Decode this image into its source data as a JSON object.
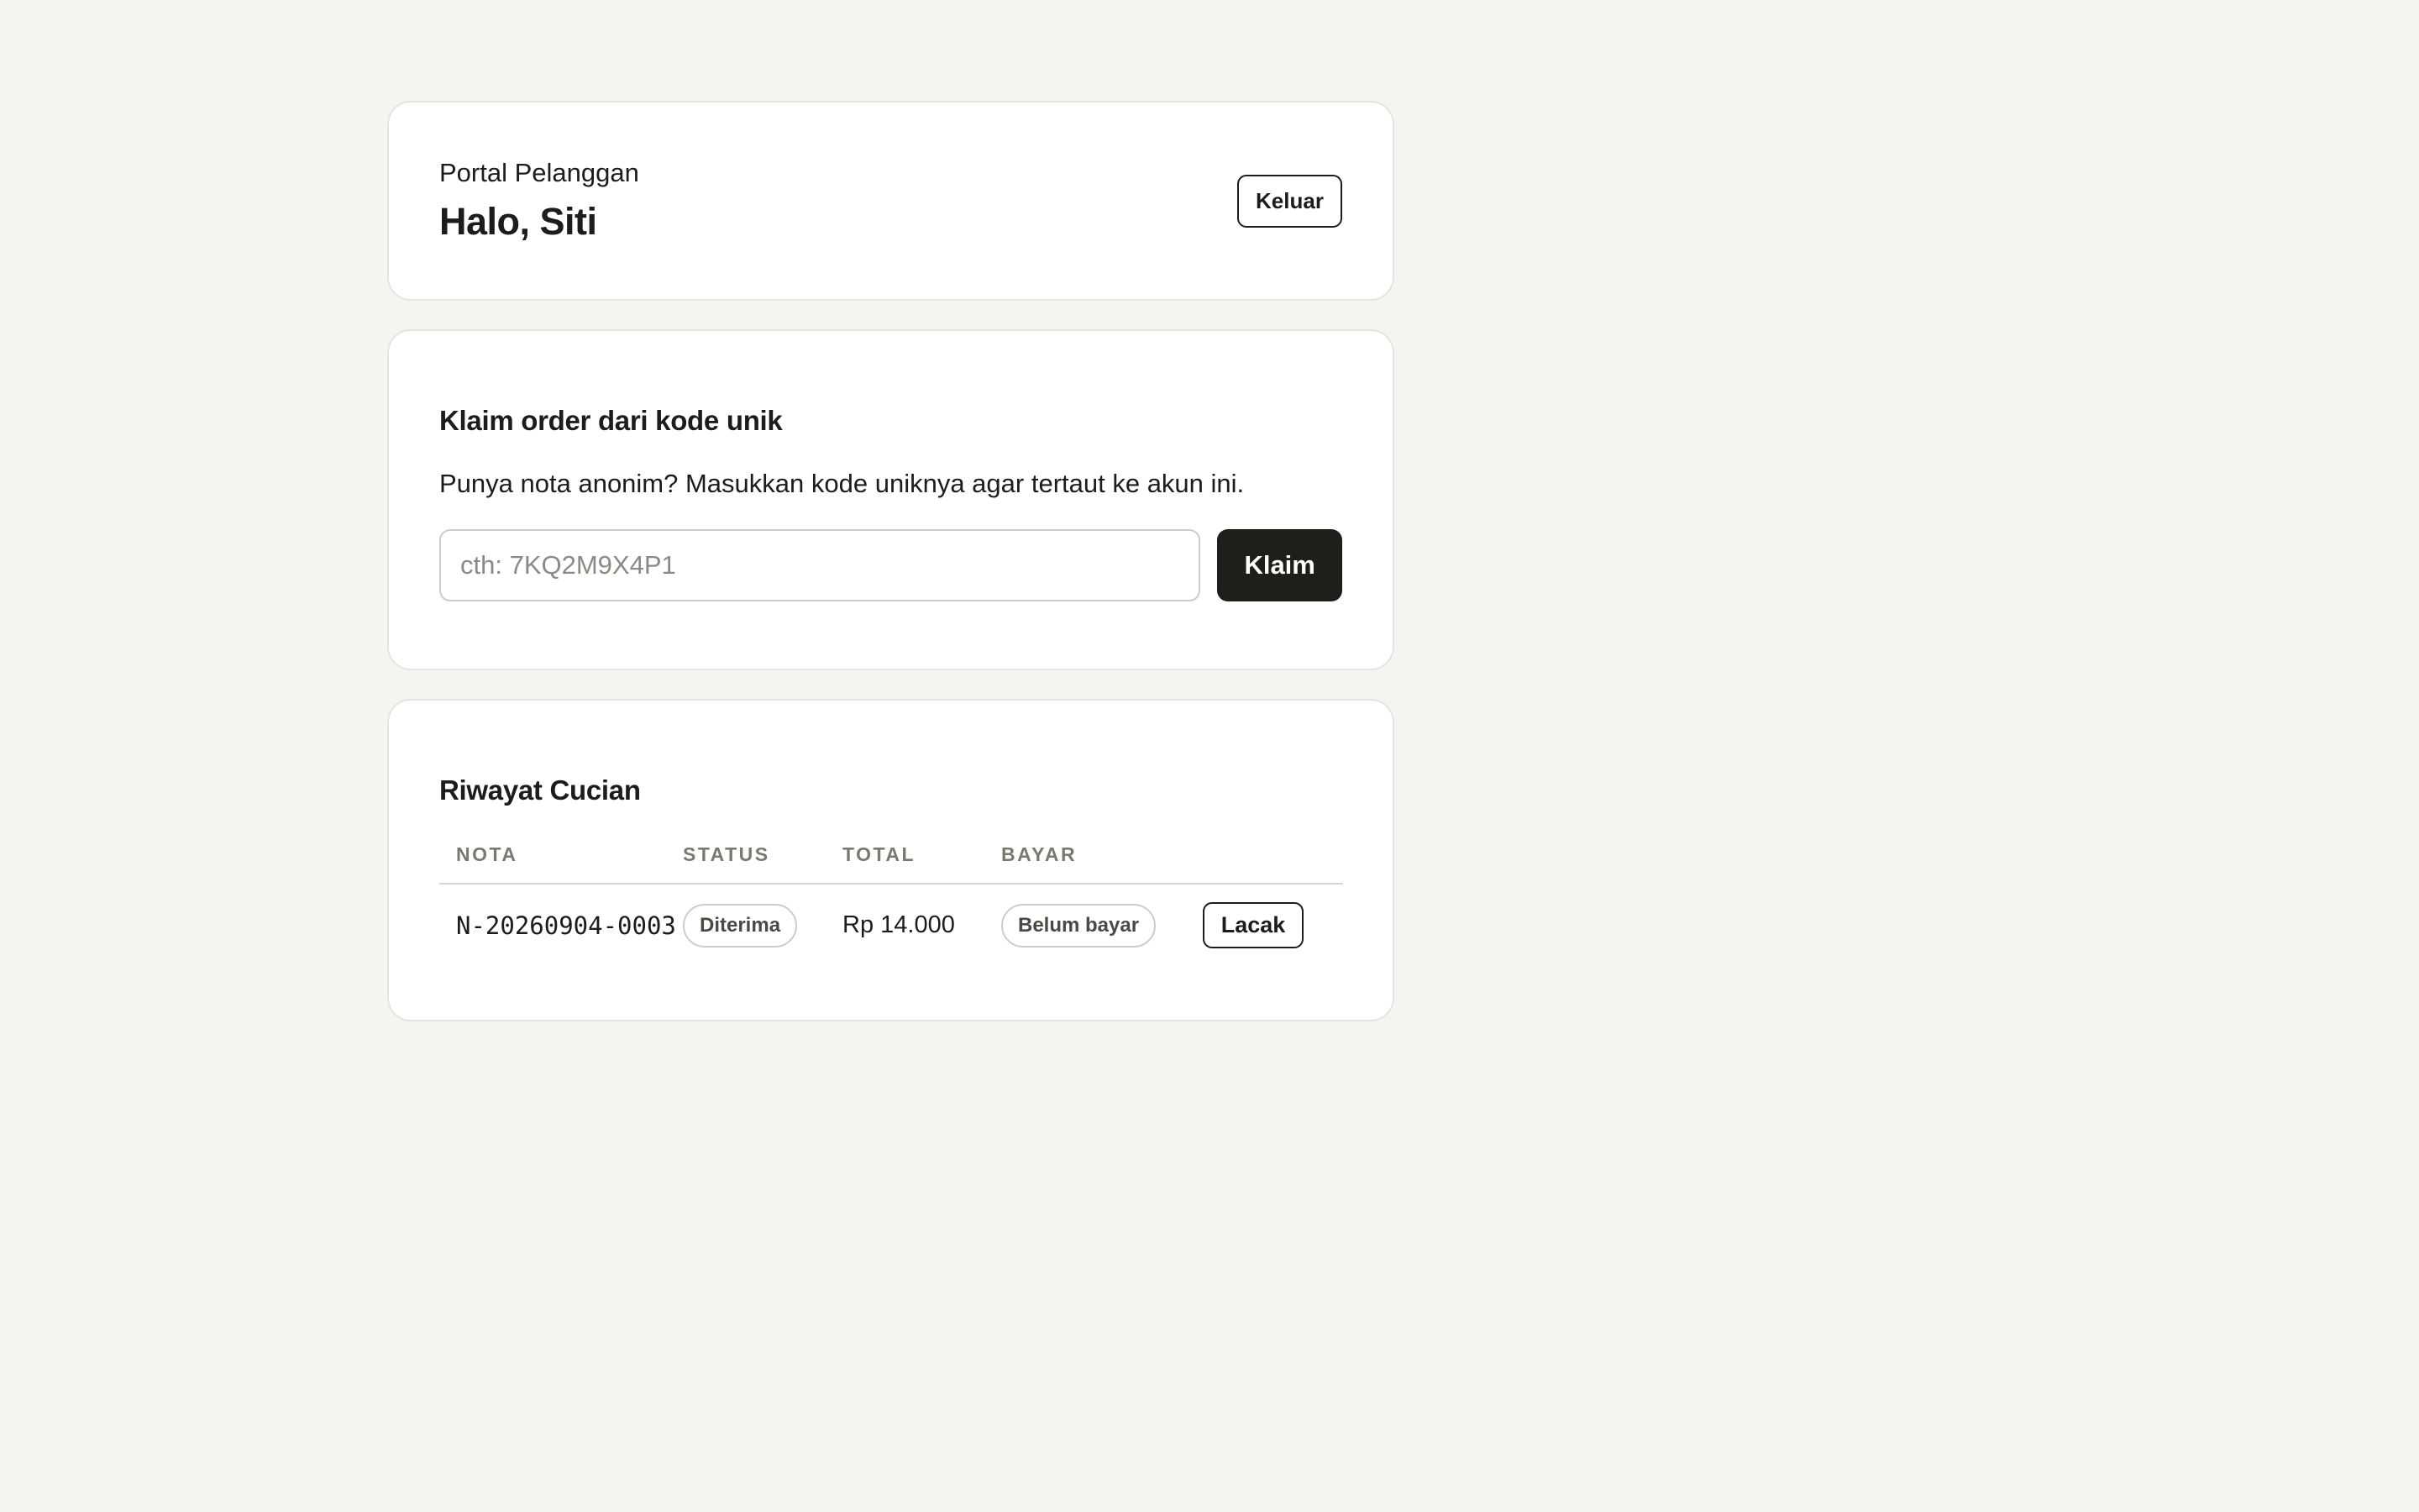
{
  "header": {
    "portal_label": "Portal Pelanggan",
    "greeting": "Halo, Siti",
    "logout_label": "Keluar"
  },
  "claim": {
    "title": "Klaim order dari kode unik",
    "description": "Punya nota anonim? Masukkan kode uniknya agar tertaut ke akun ini.",
    "input_value": "",
    "input_placeholder": "cth: 7KQ2M9X4P1",
    "button_label": "Klaim"
  },
  "history": {
    "title": "Riwayat Cucian",
    "columns": [
      "NOTA",
      "STATUS",
      "TOTAL",
      "BAYAR",
      ""
    ],
    "rows": [
      {
        "nota": "N-20260904-0003",
        "status": "Diterima",
        "total": "Rp 14.000",
        "bayar": "Belum bayar",
        "action_label": "Lacak"
      }
    ]
  },
  "colors": {
    "background": "#f5f4f0",
    "primary_button": "#1f1e1a",
    "muted_header": "#7a786f"
  }
}
